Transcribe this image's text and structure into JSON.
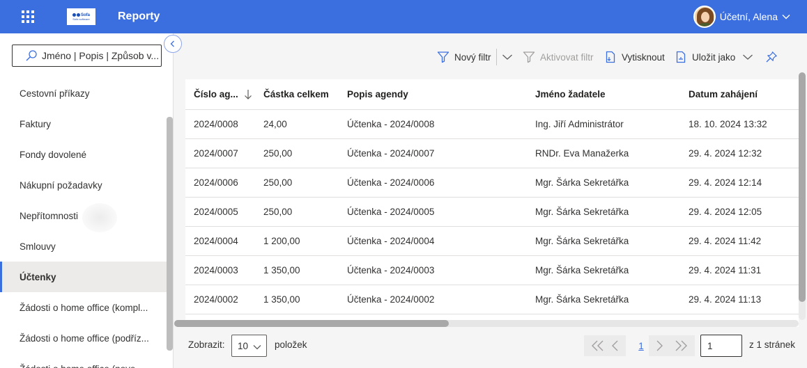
{
  "header": {
    "title": "Reporty",
    "logo": {
      "word": "Sofa",
      "sub": "Sofa software"
    },
    "user_name": "Účetní, Alena",
    "color": "#3b6fe0"
  },
  "sidebar": {
    "search_placeholder": "Jméno | Popis | Způsob v...",
    "items": [
      {
        "label": "Cestovní příkazy"
      },
      {
        "label": "Faktury"
      },
      {
        "label": "Fondy dovolené"
      },
      {
        "label": "Nákupní požadavky"
      },
      {
        "label": "Nepřítomnosti"
      },
      {
        "label": "Smlouvy"
      },
      {
        "label": "Účtenky",
        "active": true
      },
      {
        "label": "Žádosti o home office (kompl..."
      },
      {
        "label": "Žádosti o home office (podříz..."
      },
      {
        "label": "Žádosti o home office (nove..."
      }
    ]
  },
  "toolbar": {
    "new_filter": "Nový filtr",
    "activate_filter": "Aktivovat filtr",
    "print": "Vytisknout",
    "save_as": "Uložit jako"
  },
  "table": {
    "columns": [
      "Číslo ag...",
      "Částka celkem",
      "Popis agendy",
      "Jméno žadatele",
      "Datum zahájení"
    ],
    "rows": [
      [
        "2024/0008",
        "24,00",
        "Účtenka - 2024/0008",
        "Ing. Jiří Administrátor",
        "18. 10. 2024 13:32"
      ],
      [
        "2024/0007",
        "250,00",
        "Účtenka - 2024/0007",
        "RNDr. Eva Manažerka",
        "29. 4. 2024 12:32"
      ],
      [
        "2024/0006",
        "250,00",
        "Účtenka - 2024/0006",
        "Mgr. Šárka Sekretářka",
        "29. 4. 2024 12:14"
      ],
      [
        "2024/0005",
        "250,00",
        "Účtenka - 2024/0005",
        "Mgr. Šárka Sekretářka",
        "29. 4. 2024 12:05"
      ],
      [
        "2024/0004",
        "1 200,00",
        "Účtenka - 2024/0004",
        "Mgr. Šárka Sekretářka",
        "29. 4. 2024 11:42"
      ],
      [
        "2024/0003",
        "1 350,00",
        "Účtenka - 2024/0003",
        "Mgr. Šárka Sekretářka",
        "29. 4. 2024 11:31"
      ],
      [
        "2024/0002",
        "1 350,00",
        "Účtenka - 2024/0002",
        "Mgr. Šárka Sekretářka",
        "29. 4. 2024 11:13"
      ]
    ]
  },
  "pager": {
    "show_label": "Zobrazit:",
    "page_size": "10",
    "items_label": "položek",
    "current_page": "1",
    "page_input": "1",
    "total_label": "z 1 stránek"
  },
  "icons": [
    "waffle-icon",
    "chevron-down-icon",
    "search-icon",
    "chevron-left-icon",
    "filter-icon",
    "filter-disabled-icon",
    "print-icon",
    "save-icon",
    "pin-icon",
    "sort-down-icon",
    "first-page-icon",
    "prev-page-icon",
    "next-page-icon",
    "last-page-icon"
  ]
}
